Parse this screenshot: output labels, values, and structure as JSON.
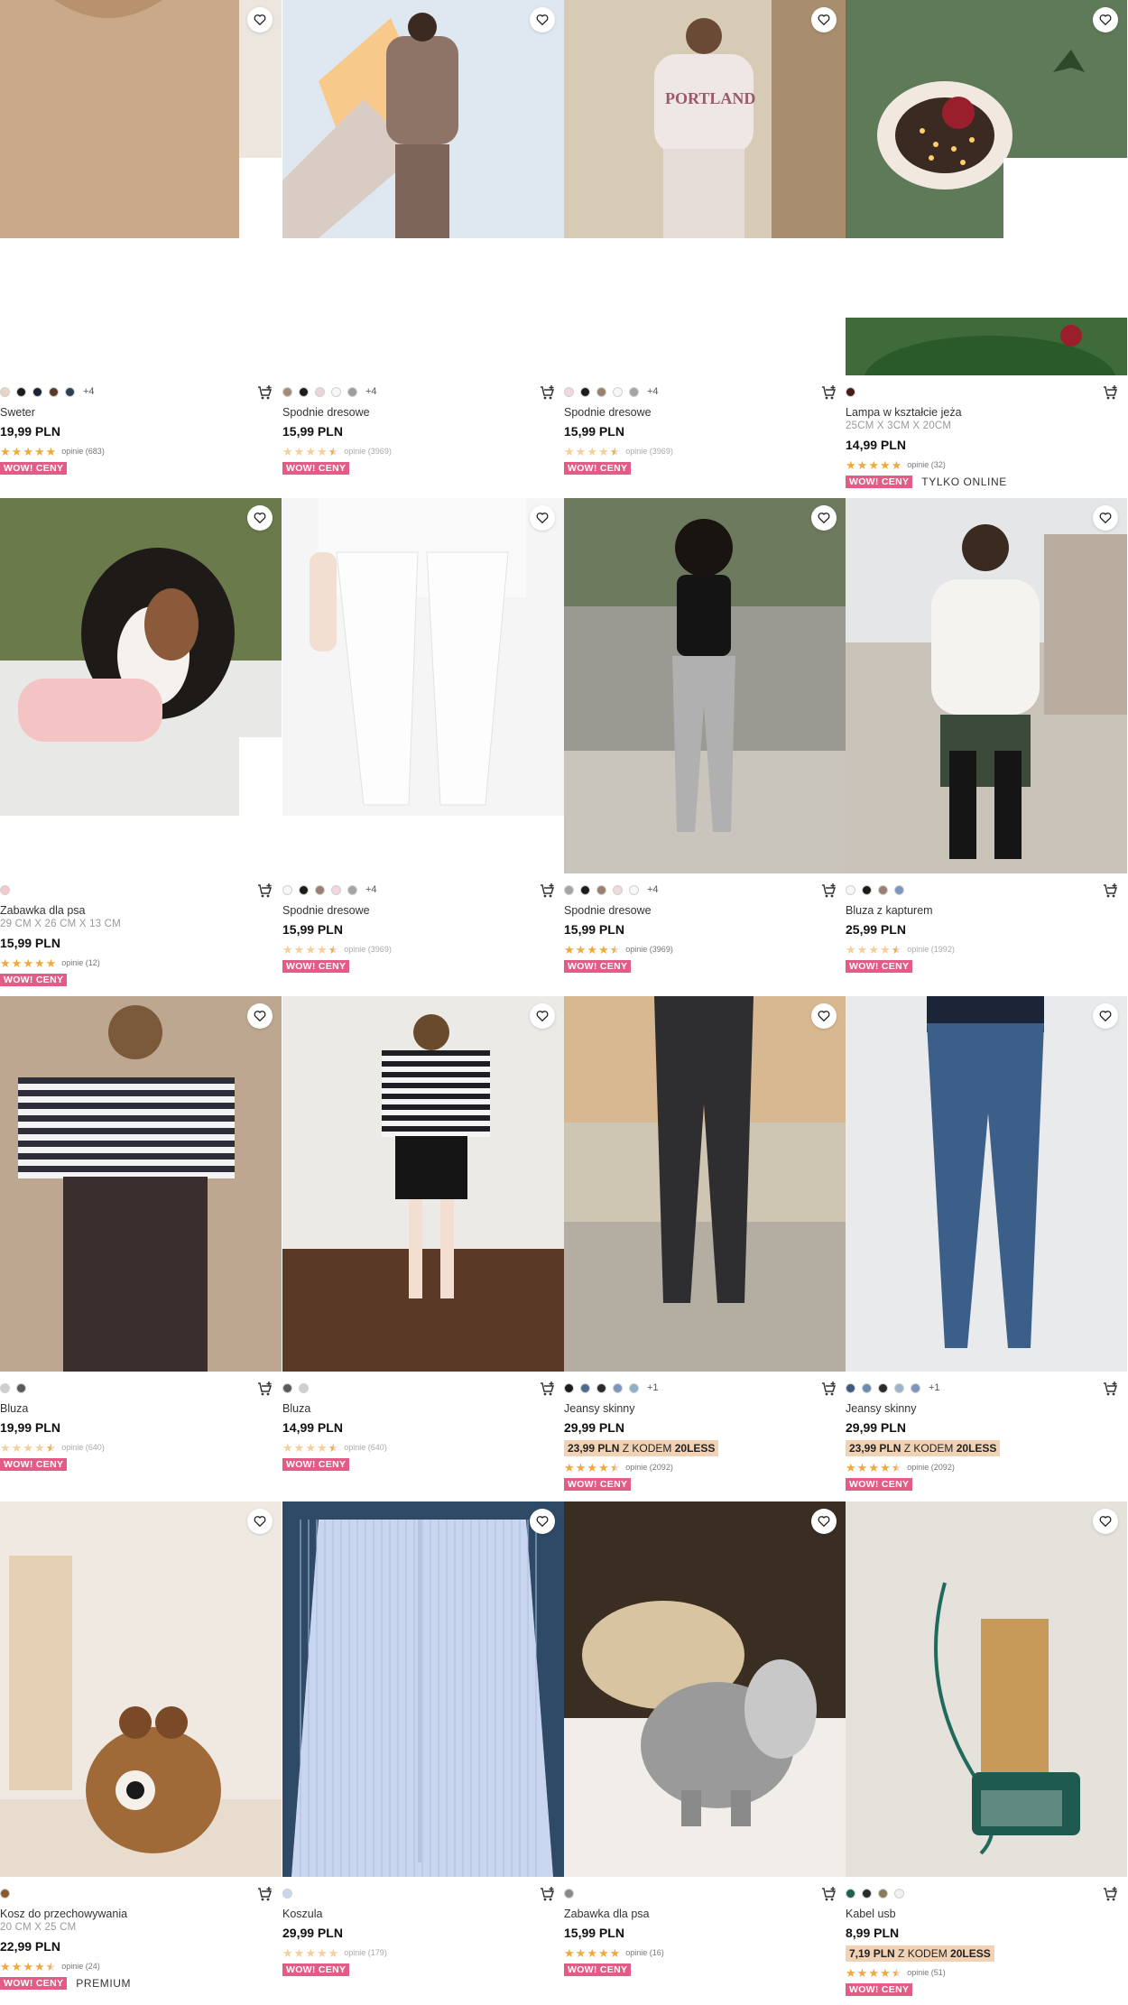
{
  "products": [
    {
      "name": "Sweter",
      "sub": "",
      "price": "19,99 PLN",
      "promo_price": "",
      "promo_text": "",
      "promo_code": "",
      "swatches": [
        "#e9d4c3",
        "#1c1c1c",
        "#1a2236",
        "#5a3a25",
        "#2f3f5a"
      ],
      "more": "+4",
      "reviews": "opinie (683)",
      "stars": 5,
      "pale": false,
      "badge": "WOW! CENY",
      "tag": "",
      "image": "sweater"
    },
    {
      "name": "Spodnie dresowe",
      "sub": "",
      "price": "15,99 PLN",
      "promo_price": "",
      "promo_text": "",
      "promo_code": "",
      "swatches": [
        "#a48a78",
        "#1c1c1c",
        "#e8d6d6",
        "#f7f7f7",
        "#9e9e9e"
      ],
      "more": "+4",
      "reviews": "opinie (3969)",
      "stars": 4.5,
      "pale": true,
      "badge": "WOW! CENY",
      "tag": "",
      "image": "tracksuit"
    },
    {
      "name": "Spodnie dresowe",
      "sub": "",
      "price": "15,99 PLN",
      "promo_price": "",
      "promo_text": "",
      "promo_code": "",
      "swatches": [
        "#f0d8dc",
        "#1c1c1c",
        "#9a7e70",
        "#f7f7f7",
        "#a5a5a5"
      ],
      "more": "+4",
      "reviews": "opinie (3969)",
      "stars": 4.5,
      "pale": true,
      "badge": "WOW! CENY",
      "tag": "",
      "image": "portland"
    },
    {
      "name": "Lampa w kształcie jeża",
      "sub": "25CM X 3CM X 20CM",
      "price": "14,99 PLN",
      "promo_price": "",
      "promo_text": "",
      "promo_code": "",
      "swatches": [
        "#4a1a1a"
      ],
      "more": "",
      "reviews": "opinie (32)",
      "stars": 5,
      "pale": false,
      "badge": "WOW! CENY",
      "tag": "TYLKO ONLINE",
      "image": "lamp"
    },
    {
      "name": "Zabawka dla psa",
      "sub": "29 CM X 26 CM X 13 CM",
      "price": "15,99 PLN",
      "promo_price": "",
      "promo_text": "",
      "promo_code": "",
      "swatches": [
        "#f4c9cc"
      ],
      "more": "",
      "reviews": "opinie (12)",
      "stars": 5,
      "pale": false,
      "badge": "WOW! CENY",
      "tag": "",
      "image": "dog"
    },
    {
      "name": "Spodnie dresowe",
      "sub": "",
      "price": "15,99 PLN",
      "promo_price": "",
      "promo_text": "",
      "promo_code": "",
      "swatches": [
        "#f7f7f7",
        "#1c1c1c",
        "#9a7e70",
        "#f0d8dc",
        "#a5a5a5"
      ],
      "more": "+4",
      "reviews": "opinie (3969)",
      "stars": 4.5,
      "pale": true,
      "badge": "WOW! CENY",
      "tag": "",
      "image": "whitepants"
    },
    {
      "name": "Spodnie dresowe",
      "sub": "",
      "price": "15,99 PLN",
      "promo_price": "",
      "promo_text": "",
      "promo_code": "",
      "swatches": [
        "#a5a5a5",
        "#1c1c1c",
        "#9a7e70",
        "#f0d8dc",
        "#f7f7f7"
      ],
      "more": "+4",
      "reviews": "opinie (3969)",
      "stars": 4.5,
      "pale": false,
      "badge": "WOW! CENY",
      "tag": "",
      "image": "greypants"
    },
    {
      "name": "Bluza z kapturem",
      "sub": "",
      "price": "25,99 PLN",
      "promo_price": "",
      "promo_text": "",
      "promo_code": "",
      "swatches": [
        "#f7f7f7",
        "#1c1c1c",
        "#9a7e70",
        "#7d96bd"
      ],
      "more": "",
      "reviews": "opinie (1992)",
      "stars": 4.5,
      "pale": true,
      "badge": "WOW! CENY",
      "tag": "",
      "image": "hoodie"
    },
    {
      "name": "Bluza",
      "sub": "",
      "price": "19,99 PLN",
      "promo_price": "",
      "promo_text": "",
      "promo_code": "",
      "swatches": [
        "#cfcfcf",
        "#5a5a5a"
      ],
      "more": "",
      "reviews": "opinie (640)",
      "stars": 4.5,
      "pale": true,
      "badge": "WOW! CENY",
      "tag": "",
      "image": "stripes1"
    },
    {
      "name": "Bluza",
      "sub": "",
      "price": "14,99 PLN",
      "promo_price": "",
      "promo_text": "",
      "promo_code": "",
      "swatches": [
        "#5a5a5a",
        "#cfcfcf"
      ],
      "more": "",
      "reviews": "opinie (640)",
      "stars": 4.5,
      "pale": true,
      "badge": "WOW! CENY",
      "tag": "",
      "image": "stripes2"
    },
    {
      "name": "Jeansy skinny",
      "sub": "",
      "price": "29,99 PLN",
      "promo_price": "23,99 PLN",
      "promo_text": "Z KODEM",
      "promo_code": "20LESS",
      "swatches": [
        "#1c1c1c",
        "#4f6a8f",
        "#2a2a2a",
        "#7d96bd",
        "#8eb0c9"
      ],
      "more": "+1",
      "reviews": "opinie (2092)",
      "stars": 4.5,
      "pale": false,
      "badge": "WOW! CENY",
      "tag": "",
      "image": "blackjeans"
    },
    {
      "name": "Jeansy skinny",
      "sub": "",
      "price": "29,99 PLN",
      "promo_price": "23,99 PLN",
      "promo_text": "Z KODEM",
      "promo_code": "20LESS",
      "swatches": [
        "#3d5a82",
        "#6c8bb0",
        "#2a2a2a",
        "#9db5cc",
        "#7d96bd"
      ],
      "more": "+1",
      "reviews": "opinie (2092)",
      "stars": 4.5,
      "pale": false,
      "badge": "WOW! CENY",
      "tag": "",
      "image": "bluejeans"
    },
    {
      "name": "Kosz do przechowywania",
      "sub": "20 CM X 25 CM",
      "price": "22,99 PLN",
      "promo_price": "",
      "promo_text": "",
      "promo_code": "",
      "swatches": [
        "#8a5a2b"
      ],
      "more": "",
      "reviews": "opinie (24)",
      "stars": 4.5,
      "pale": false,
      "badge": "WOW! CENY",
      "tag": "PREMIUM",
      "image": "basket"
    },
    {
      "name": "Koszula",
      "sub": "",
      "price": "29,99 PLN",
      "promo_price": "",
      "promo_text": "",
      "promo_code": "",
      "swatches": [
        "#c9d6ef"
      ],
      "more": "",
      "reviews": "opinie (179)",
      "stars": 5,
      "pale": true,
      "badge": "WOW! CENY",
      "tag": "",
      "image": "shirt"
    },
    {
      "name": "Zabawka dla psa",
      "sub": "",
      "price": "15,99 PLN",
      "promo_price": "",
      "promo_text": "",
      "promo_code": "",
      "swatches": [
        "#8a8a8a"
      ],
      "more": "",
      "reviews": "opinie (16)",
      "stars": 5,
      "pale": false,
      "badge": "WOW! CENY",
      "tag": "",
      "image": "elephant"
    },
    {
      "name": "Kabel usb",
      "sub": "",
      "price": "8,99 PLN",
      "promo_price": "7,19 PLN",
      "promo_text": "Z KODEM",
      "promo_code": "20LESS",
      "swatches": [
        "#1f5f4f",
        "#2a2a2a",
        "#8a7a5a",
        "#f0f0f0"
      ],
      "more": "",
      "reviews": "opinie (51)",
      "stars": 4.5,
      "pale": false,
      "badge": "WOW! CENY",
      "tag": "",
      "image": "usb"
    }
  ],
  "colors": {
    "accent_pink": "#e25d86",
    "star": "#f0a93a",
    "promo_bg": "#f1d2b4"
  },
  "icons": {
    "favorite": "heart-icon",
    "cart": "add-to-cart-icon"
  }
}
